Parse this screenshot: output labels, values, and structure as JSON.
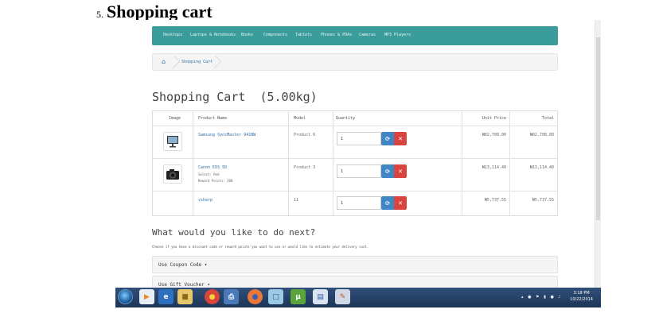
{
  "document": {
    "item_number": "5.",
    "heading": "Shopping cart"
  },
  "menu": {
    "items": [
      "Desktops",
      "Laptops & Notebooks",
      "Books",
      "Components",
      "Tablets",
      "Phones & PDAs",
      "Cameras",
      "MP3 Players"
    ]
  },
  "breadcrumb": {
    "home_icon": "home-icon",
    "current": "Shopping Cart"
  },
  "cart": {
    "title": "Shopping Cart",
    "weight": "(5.00kg)",
    "columns": [
      "Image",
      "Product Name",
      "Model",
      "Quantity",
      "Unit Price",
      "Total"
    ],
    "rows": [
      {
        "image_icon": "monitor-icon",
        "name": "Samsung SyncMaster 941BW",
        "details": [],
        "model": "Product 6",
        "quantity": "1",
        "unit_price": "₦82,708.00",
        "total": "₦82,708.00"
      },
      {
        "image_icon": "camera-icon",
        "name": "Canon EOS 5D",
        "details": [
          "Select: Red",
          "Reward Points: 200"
        ],
        "model": "Product 3",
        "quantity": "1",
        "unit_price": "₦13,114.40",
        "total": "₦13,114.40"
      },
      {
        "image_icon": "",
        "name": "vsharp",
        "details": [],
        "model": "11",
        "quantity": "1",
        "unit_price": "₦5,737.55",
        "total": "₦5,737.55"
      }
    ]
  },
  "next": {
    "title": "What would you like to do next?",
    "help": "Choose if you have a discount code or reward points you want to use or would like to estimate your delivery cost.",
    "coupon_label": "Use Coupon Code ▾",
    "voucher_label": "Use Gift Voucher ▾"
  },
  "taskbar": {
    "time": "3:18 PM",
    "date": "10/22/2014",
    "apps": [
      "media-player-icon",
      "internet-explorer-icon",
      "folder-icon",
      "chrome-icon",
      "printer-icon",
      "firefox-icon",
      "window-icon",
      "utorrent-icon",
      "document-icon",
      "paint-icon"
    ]
  },
  "colors": {
    "menu_bar": "#3a9d9c",
    "link": "#2a6fa8",
    "update_button": "#3f86c6",
    "remove_button": "#d9443f",
    "taskbar": "#1d3556"
  }
}
